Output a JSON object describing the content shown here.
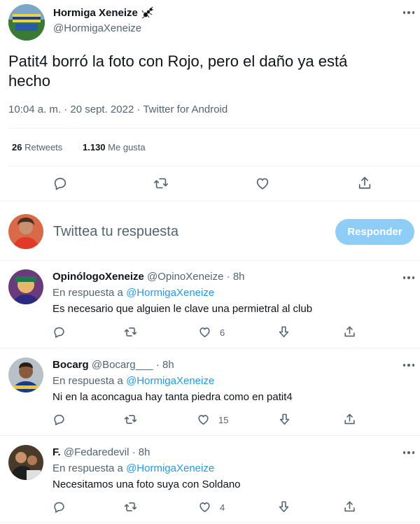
{
  "author": {
    "name": "Hormiga Xeneize",
    "handle": "@HormigaXeneize",
    "badge_icon": "ant-icon"
  },
  "tweet": {
    "text_line1": "Patit4 borró la foto con Rojo, pero el daño ya está",
    "text_line2": "hecho",
    "time": "10:04 a. m. · 20 sept. 2022 · Twitter for Android",
    "retweets_count": "26",
    "retweets_label": "Retweets",
    "likes_count": "1.130",
    "likes_label": "Me gusta"
  },
  "compose": {
    "placeholder": "Twittea tu respuesta",
    "button_label": "Responder"
  },
  "replies": [
    {
      "name": "OpinólogoXeneize",
      "handle": "@OpinoXeneize",
      "time": "· 8h",
      "reply_prefix": "En respuesta a",
      "reply_to": "@HormigaXeneize",
      "text": "Es necesario que alguien le clave una permietral al club",
      "likes": "6"
    },
    {
      "name": "Bocarg",
      "handle": "@Bocarg___",
      "time": "· 8h",
      "reply_prefix": "En respuesta a",
      "reply_to": "@HormigaXeneize",
      "text": "Ni en la aconcagua hay tanta piedra como en patit4",
      "likes": "15"
    },
    {
      "name": "F.",
      "handle": "@Fedaredevil",
      "time": "· 8h",
      "reply_prefix": "En respuesta a",
      "reply_to": "@HormigaXeneize",
      "text": "Necesitamos una foto suya con Soldano",
      "likes": "4"
    }
  ],
  "colors": {
    "text": "#0f1419",
    "muted": "#536471",
    "accent": "#1d9bf0",
    "button_disabled": "#8ecdf8",
    "divider": "#eff3f4"
  },
  "icons": {
    "reply": "reply-icon",
    "retweet": "retweet-icon",
    "like": "heart-icon",
    "share": "share-icon",
    "more": "more-icon",
    "downvote": "downvote-icon"
  }
}
